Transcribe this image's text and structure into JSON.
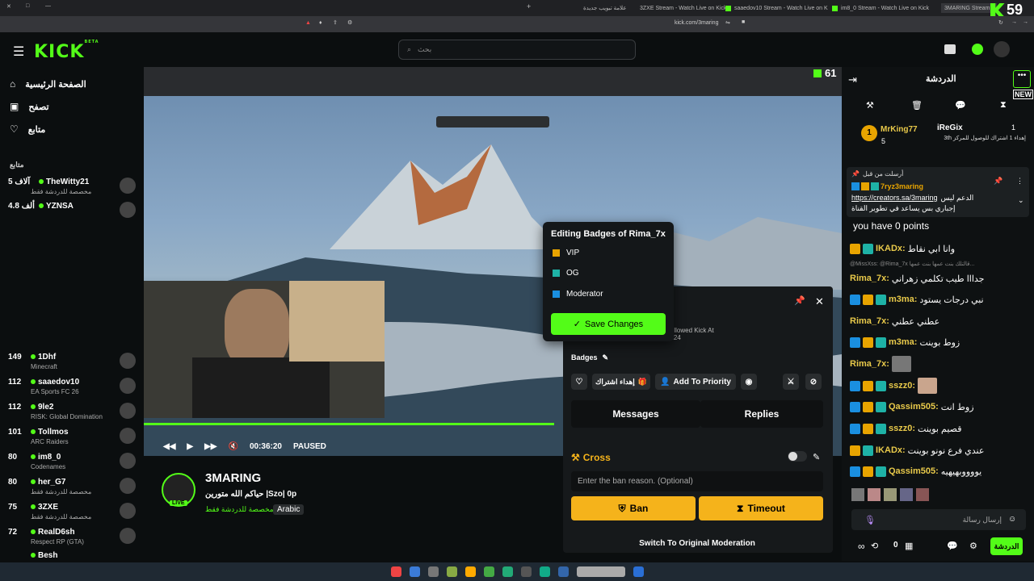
{
  "browser": {
    "tabs": [
      {
        "label": "علامة تبويب جديدة"
      },
      {
        "label": "3ZXE Stream - Watch Live on Kick"
      },
      {
        "label": "saaedov10 Stream - Watch Live on K"
      },
      {
        "label": "im8_0 Stream - Watch Live on Kick"
      },
      {
        "label": "3MARING Stream -"
      }
    ],
    "url": "kick.com/3maring",
    "overlay_count": "59"
  },
  "topnav": {
    "logo": "KICK",
    "logo_badge": "BETA",
    "search_placeholder": "بحث"
  },
  "sidebar": {
    "nav": [
      {
        "label": "الصفحة الرئيسية",
        "icon": "home-icon"
      },
      {
        "label": "تصفح",
        "icon": "browse-icon"
      },
      {
        "label": "متابع",
        "icon": "heart-icon"
      }
    ],
    "following_title": "متابع",
    "channels": [
      {
        "viewers": "5 آلاف",
        "name": "TheWitty21",
        "category": "مخصصة للدردشة فقط"
      },
      {
        "viewers": "4.8 ألف",
        "name": "YZNSA",
        "category": ""
      },
      {
        "viewers": "149",
        "name": "1Dhf",
        "category": "Minecraft"
      },
      {
        "viewers": "112",
        "name": "saaedov10",
        "category": "EA Sports FC 26"
      },
      {
        "viewers": "112",
        "name": "9le2",
        "category": "RISK: Global Domination"
      },
      {
        "viewers": "101",
        "name": "Tollmos",
        "category": "ARC Raiders"
      },
      {
        "viewers": "80",
        "name": "im8_0",
        "category": "Codenames"
      },
      {
        "viewers": "80",
        "name": "her_G7",
        "category": "مخصصة للدردشة فقط"
      },
      {
        "viewers": "75",
        "name": "3ZXE",
        "category": "مخصصة للدردشة فقط"
      },
      {
        "viewers": "72",
        "name": "RealD6sh",
        "category": "Respect RP (GTA)"
      },
      {
        "viewers": "",
        "name": "Besh",
        "category": ""
      }
    ]
  },
  "video": {
    "overlay_viewers": "61",
    "time": "00:36:20",
    "status": "PAUSED"
  },
  "stream": {
    "name": "3MARING",
    "title": "حياكم الله متورين |Szo| 0p",
    "category": "مخصصة للدردشة فقط",
    "language": "Arabic",
    "live_badge": "LIVE"
  },
  "badge_editor": {
    "title": "Editing Badges of Rima_7x",
    "options": [
      "VIP",
      "OG",
      "Moderator"
    ],
    "save_label": "Save Changes"
  },
  "modpanel": {
    "followed_label": "Followed Kick At",
    "followed_year": "2024",
    "badges_label": "Badges",
    "gift_sub": "إهداء اشتراك",
    "add_priority": "Add To Priority",
    "messages_tab": "Messages",
    "replies_tab": "Replies",
    "cross_label": "Cross",
    "ban_reason_placeholder": "Enter the ban reason. (Optional)",
    "ban_label": "Ban",
    "timeout_label": "Timeout",
    "switch_label": "Switch To Original Moderation"
  },
  "chat": {
    "title": "الدردشة",
    "new_label": "NEW",
    "leaderboard": [
      {
        "rank": "1",
        "name": "MrKing77",
        "count": "5"
      },
      {
        "name": "iReGix",
        "count": "1",
        "text": "إهداء 1 اشتراك للوصول للمركز 3th"
      }
    ],
    "pinned": {
      "header": "أرسلت من قبل",
      "user": "7ryz3maring",
      "link": "https://creators.sa/3maring",
      "link_text": "الدعم ليس",
      "text": "إجباري بس يساعد في تطوير القناة"
    },
    "points_text": "you have 0 points",
    "messages": [
      {
        "user": "IKADx:",
        "text": "وانا ابي نقاط",
        "badges": [
          "vip",
          "og"
        ],
        "color": "#e8c94a"
      },
      {
        "reply": "@MissXss: @Rima_7x قالتلك بنت عمها بنت عمها..."
      },
      {
        "user": "Rima_7x:",
        "text": "جدااا طيب تكلمي زهراني",
        "badges": [],
        "color": "#e8c94a"
      },
      {
        "user": "m3ma:",
        "text": "نبي درجات يستود",
        "badges": [
          "mod",
          "vip",
          "og"
        ],
        "color": "#e8c94a"
      },
      {
        "user": "Rima_7x:",
        "text": "عطني عطني",
        "badges": [],
        "color": "#e8c94a"
      },
      {
        "user": "m3ma:",
        "text": "زوط بوينت",
        "badges": [
          "mod",
          "vip",
          "og"
        ],
        "color": "#e8c94a"
      },
      {
        "user": "Rima_7x:",
        "text": "",
        "badges": [],
        "color": "#e8c94a"
      },
      {
        "user": "sszz0:",
        "text": "",
        "badges": [
          "mod",
          "vip",
          "og"
        ],
        "color": "#e8c94a"
      },
      {
        "user": "Qassim505:",
        "text": "زوط انت",
        "badges": [
          "mod",
          "vip",
          "og"
        ],
        "color": "#e8c94a"
      },
      {
        "user": "sszz0:",
        "text": "قصيم بوينت",
        "badges": [
          "mod",
          "vip",
          "og"
        ],
        "color": "#e8c94a"
      },
      {
        "user": "IKADx:",
        "text": "عندي فرع نونو بوينت",
        "badges": [
          "vip",
          "og"
        ],
        "color": "#e8c94a"
      },
      {
        "user": "Qassim505:",
        "text": "يووووبهيهيه",
        "badges": [
          "mod",
          "vip",
          "og"
        ],
        "color": "#e8c94a"
      }
    ],
    "input_placeholder": "إرسال رسالة",
    "send_label": "الدردشة",
    "points_count": "0"
  },
  "colors": {
    "accent": "#53fc18",
    "button": "#f5b31b",
    "bg": "#0b0e0f"
  }
}
